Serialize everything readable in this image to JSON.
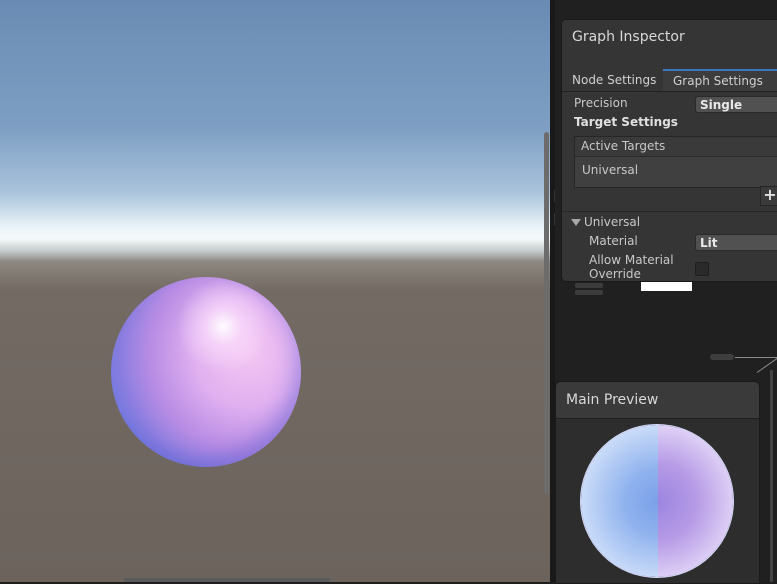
{
  "inspector": {
    "title": "Graph Inspector",
    "tabs": [
      {
        "label": "Node Settings",
        "active": false
      },
      {
        "label": "Graph Settings",
        "active": true
      }
    ],
    "precision": {
      "label": "Precision",
      "value": "Single"
    },
    "target_settings": {
      "heading": "Target Settings",
      "active_targets_label": "Active Targets",
      "targets": [
        "Universal"
      ],
      "add_symbol": "+"
    },
    "universal_section": {
      "title": "Universal",
      "expanded": true,
      "material": {
        "label": "Material",
        "value": "Lit"
      },
      "allow_override": {
        "label_line1": "Allow Material",
        "label_line2": "Override",
        "checked": false
      }
    }
  },
  "preview": {
    "title": "Main Preview"
  },
  "colors": {
    "accent_tab": "#3a79bb",
    "panel": "#353535",
    "canvas": "#202020"
  }
}
